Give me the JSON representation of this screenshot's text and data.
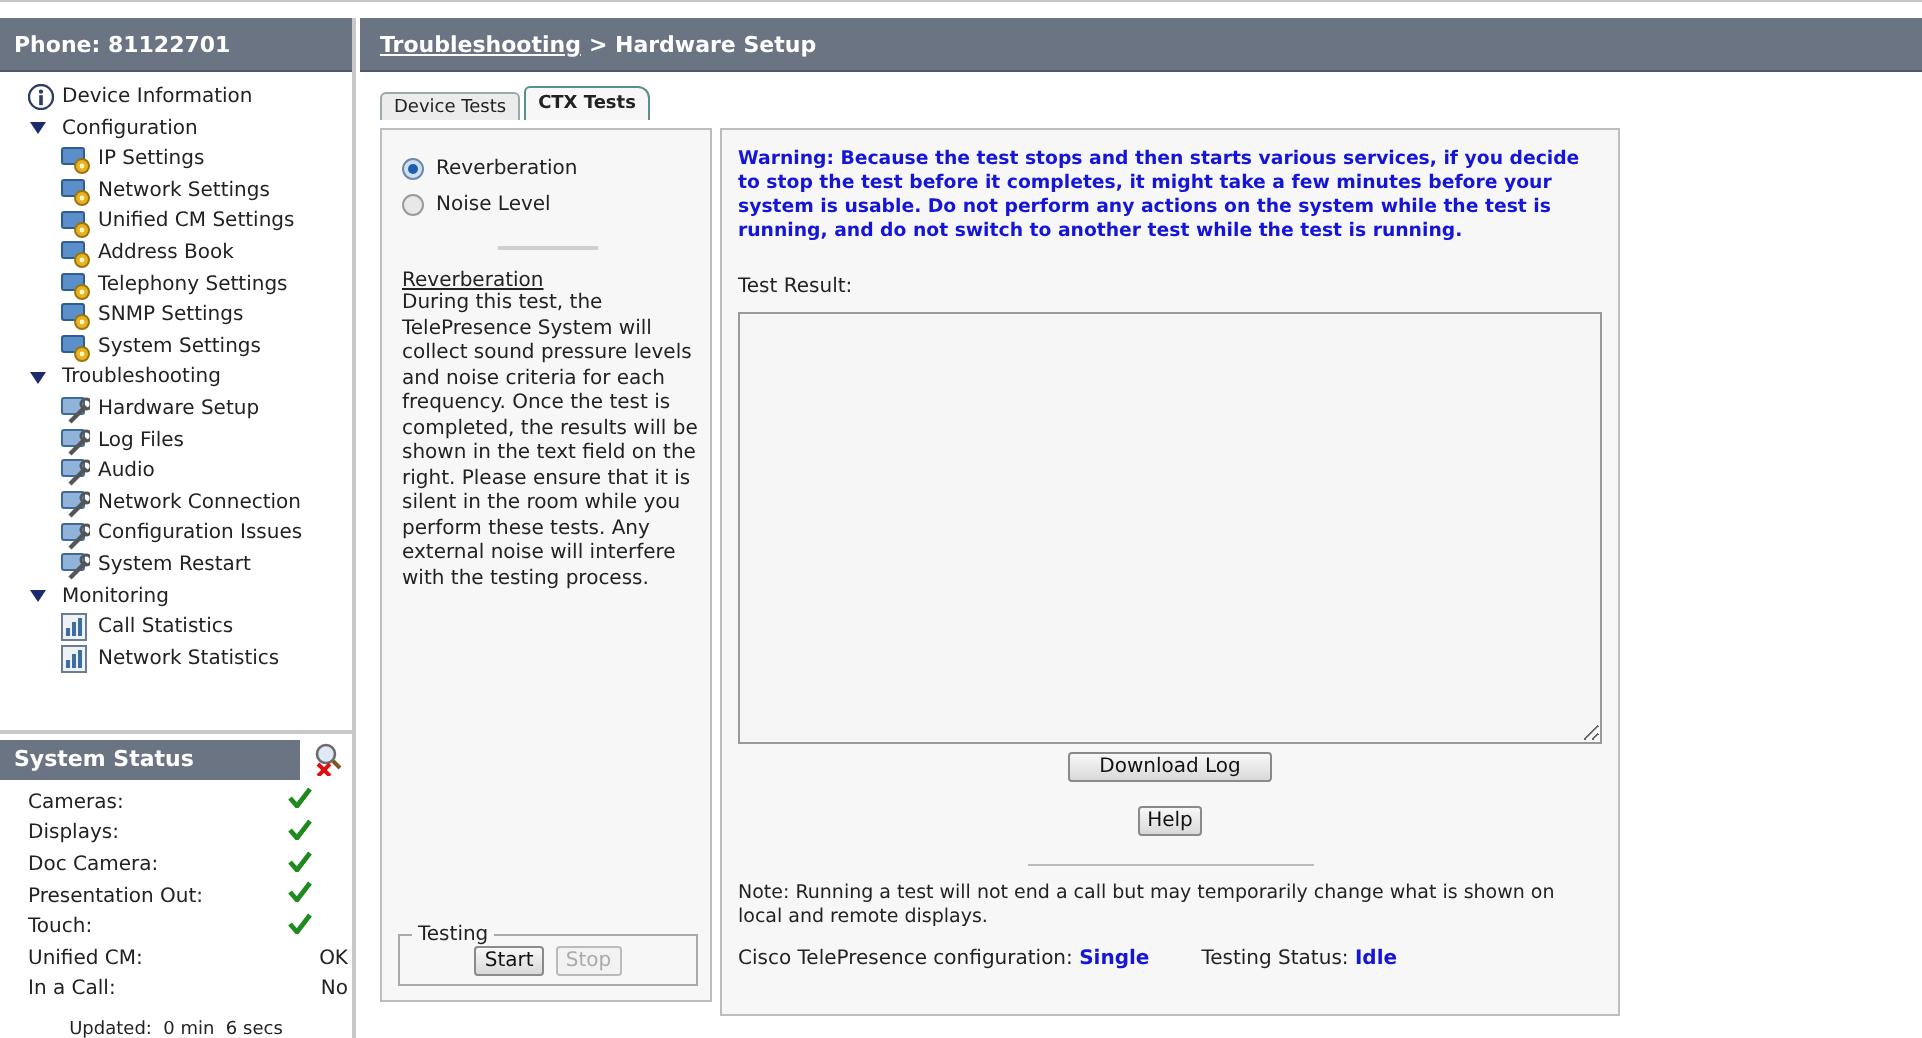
{
  "sidebar": {
    "title": "Phone: 81122701",
    "nav": [
      {
        "label": "Device Information",
        "kind": "info"
      },
      {
        "label": "Configuration",
        "kind": "group",
        "expanded": true,
        "children": [
          {
            "label": "IP Settings"
          },
          {
            "label": "Network Settings"
          },
          {
            "label": "Unified CM Settings"
          },
          {
            "label": "Address Book"
          },
          {
            "label": "Telephony Settings"
          },
          {
            "label": "SNMP Settings"
          },
          {
            "label": "System Settings"
          }
        ]
      },
      {
        "label": "Troubleshooting",
        "kind": "group",
        "expanded": true,
        "children": [
          {
            "label": "Hardware Setup"
          },
          {
            "label": "Log Files"
          },
          {
            "label": "Audio"
          },
          {
            "label": "Network Connection"
          },
          {
            "label": "Configuration Issues"
          },
          {
            "label": "System Restart"
          }
        ]
      },
      {
        "label": "Monitoring",
        "kind": "group",
        "expanded": true,
        "children": [
          {
            "label": "Call Statistics"
          },
          {
            "label": "Network Statistics"
          }
        ]
      }
    ]
  },
  "system_status": {
    "title": "System Status",
    "rows": [
      {
        "label": "Cameras:",
        "kind": "check"
      },
      {
        "label": "Displays:",
        "kind": "check"
      },
      {
        "label": "Doc Camera:",
        "kind": "check"
      },
      {
        "label": "Presentation Out:",
        "kind": "check"
      },
      {
        "label": "Touch:",
        "kind": "check"
      },
      {
        "label": "Unified CM:",
        "kind": "text",
        "value": "OK"
      },
      {
        "label": "In a Call:",
        "kind": "text",
        "value": "No"
      }
    ],
    "updated": "Updated:  0 min  6 secs"
  },
  "breadcrumb": {
    "link": "Troubleshooting",
    "current": "> Hardware Setup"
  },
  "tabs": [
    {
      "label": "Device Tests",
      "selected": false
    },
    {
      "label": "CTX Tests",
      "selected": true
    }
  ],
  "tests": [
    {
      "label": "Reverberation",
      "selected": true
    },
    {
      "label": "Noise Level",
      "selected": false
    }
  ],
  "description": {
    "title": "Reverberation",
    "text": "During this test, the TelePresence System will collect sound pressure levels and noise criteria for each frequency. Once the test is completed, the results will be shown in the text field on the right. Please ensure that it is silent in the room while you perform these tests. Any external noise will interfere with the testing process."
  },
  "testing": {
    "legend": "Testing",
    "buttons": [
      {
        "label": "Start",
        "disabled": false
      },
      {
        "label": "Stop",
        "disabled": true
      }
    ]
  },
  "warning": "Warning: Because the test stops and then starts various services, if you decide to stop the test before it completes, it might take a few minutes before your system is usable. Do not perform any actions on the system while the test is running, and do not switch to another test while the test is running.",
  "result_label": "Test Result:",
  "buttons": [
    {
      "label": "Download Log"
    },
    {
      "label": "Help"
    }
  ],
  "note": "Note: Running a test will not end a call but may temporarily change what is shown on local and remote displays.",
  "config": {
    "label": "Cisco TelePresence configuration:",
    "value": "Single"
  },
  "status": {
    "label": "Testing Status:",
    "value": "Idle"
  }
}
